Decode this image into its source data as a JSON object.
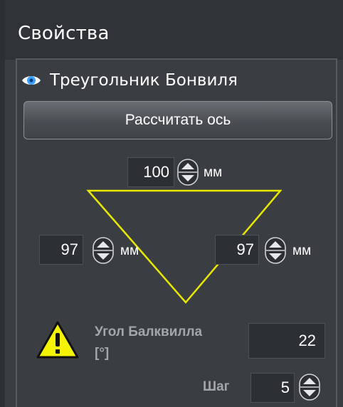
{
  "panel": {
    "title": "Свойства"
  },
  "bonwill": {
    "title": "Треугольник Бонвиля",
    "eye_icon": "eye-icon",
    "calc_button_label": "Рассчитать ось",
    "top_side": {
      "value": "100",
      "unit": "мм"
    },
    "left_side": {
      "value": "97",
      "unit": "мм"
    },
    "right_side": {
      "value": "97",
      "unit": "мм"
    },
    "triangle_color": "#e8e800",
    "warning_icon": "warning-triangle-icon",
    "angle_label_line1": "Угол Балквилла",
    "angle_label_line2": "[°]",
    "angle_value": "22",
    "step_label": "Шаг",
    "step_value": "5"
  },
  "colors": {
    "background": "#3a3e42",
    "header": "#2f3236",
    "accent_eye": "#3aa0ff",
    "warning": "#f4f400"
  }
}
